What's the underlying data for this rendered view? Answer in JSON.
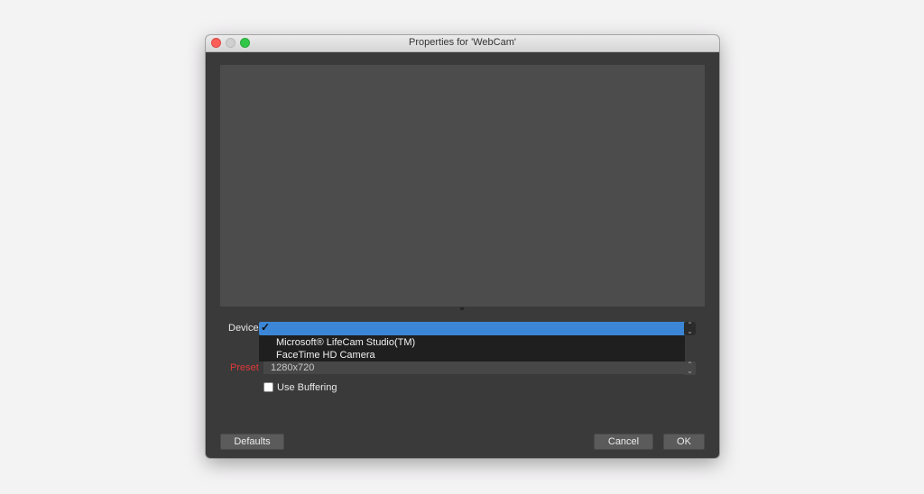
{
  "window": {
    "title": "Properties for 'WebCam'"
  },
  "device": {
    "label": "Device",
    "selected_mark": "✓",
    "options": [
      "Microsoft® LifeCam Studio(TM)",
      "FaceTime HD Camera"
    ]
  },
  "preset": {
    "label": "Preset",
    "value": "1280x720"
  },
  "buffering": {
    "label": "Use Buffering",
    "checked": false
  },
  "buttons": {
    "defaults": "Defaults",
    "cancel": "Cancel",
    "ok": "OK"
  },
  "colors": {
    "accent": "#3b86d6",
    "preset_label": "#e03838",
    "window_bg": "#3a3a3a",
    "preview_bg": "#4c4c4c"
  },
  "icons": {
    "close": "close-icon",
    "minimize": "minimize-icon",
    "zoom": "zoom-icon",
    "stepper": "up-down-chevron-icon",
    "selected": "checkmark-icon"
  }
}
